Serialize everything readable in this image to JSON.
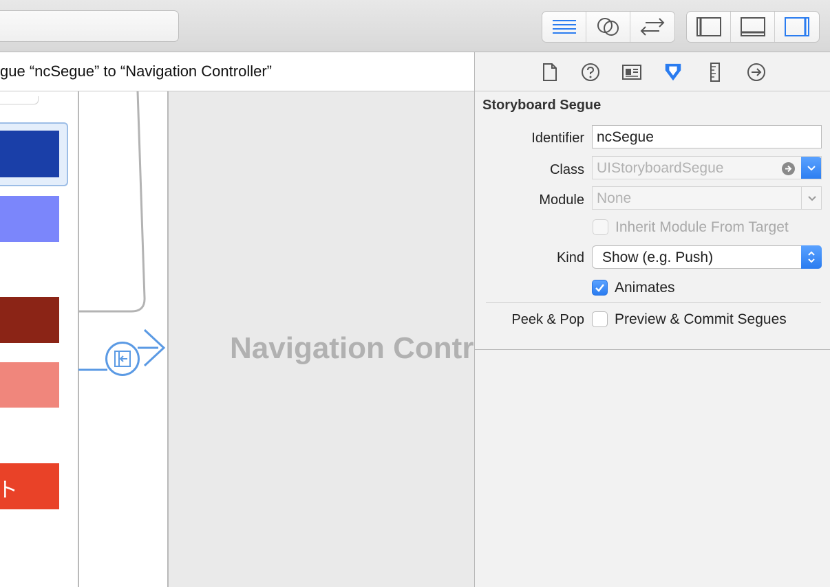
{
  "toolbar": {
    "editor_buttons": [
      {
        "icon": "standard-editor-icon",
        "active": true
      },
      {
        "icon": "assistant-editor-icon",
        "active": false
      },
      {
        "icon": "version-editor-icon",
        "active": false
      }
    ],
    "view_buttons": [
      {
        "icon": "navigator-toggle-icon",
        "active": false
      },
      {
        "icon": "debug-area-toggle-icon",
        "active": false
      },
      {
        "icon": "utilities-toggle-icon",
        "active": true
      }
    ],
    "accent": "#2a7cf0"
  },
  "jumpbar": {
    "text": "gue “ncSegue” to “Navigation Controller”"
  },
  "canvas": {
    "scene_label": "Navigation Contr",
    "tail_text": "ト",
    "colors": [
      "#1a3fa8",
      "#7b86fb",
      "#8b2416",
      "#f0867c",
      "#e94228"
    ]
  },
  "inspector": {
    "tabs": [
      {
        "icon": "file-inspector-icon",
        "active": false
      },
      {
        "icon": "quick-help-icon",
        "active": false
      },
      {
        "icon": "identity-inspector-icon",
        "active": false
      },
      {
        "icon": "attributes-inspector-icon",
        "active": true
      },
      {
        "icon": "size-inspector-icon",
        "active": false
      },
      {
        "icon": "connections-inspector-icon",
        "active": false
      }
    ],
    "section_title": "Storyboard Segue",
    "identifier": {
      "label": "Identifier",
      "value": "ncSegue"
    },
    "class": {
      "label": "Class",
      "placeholder": "UIStoryboardSegue"
    },
    "module": {
      "label": "Module",
      "placeholder": "None"
    },
    "inherit": {
      "label": "Inherit Module From Target",
      "checked": false,
      "enabled": false
    },
    "kind": {
      "label": "Kind",
      "value": "Show (e.g. Push)"
    },
    "animates": {
      "label": "Animates",
      "checked": true
    },
    "peek_pop": {
      "label": "Peek & Pop",
      "option_label": "Preview & Commit Segues",
      "checked": false
    }
  }
}
